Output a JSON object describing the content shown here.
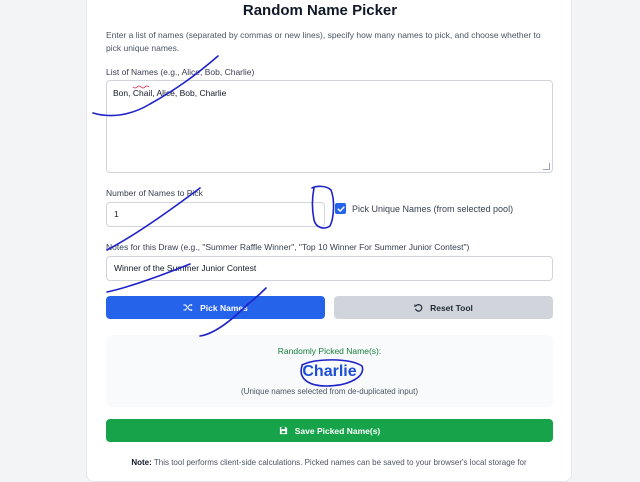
{
  "header": {
    "title": "Random Name Picker",
    "description": "Enter a list of names (separated by commas or new lines), specify how many names to pick, and choose whether to pick unique names."
  },
  "names": {
    "label": "List of Names (e.g., Alice, Bob, Charlie)",
    "value": "Bon, Chail, Alice, Bob, Charlie"
  },
  "count": {
    "label": "Number of Names to Pick",
    "value": "1"
  },
  "unique": {
    "label": "Pick Unique Names (from selected pool)",
    "checked": true
  },
  "notes": {
    "label": "Notes for this Draw (e.g., \"Summer Raffle Winner\", \"Top 10 Winner For Summer Junior Contest\")",
    "value": "Winner of the Summer Junior Contest"
  },
  "actions": {
    "pick_label": "Pick Names",
    "reset_label": "Reset Tool",
    "save_label": "Save Picked Name(s)"
  },
  "result": {
    "label": "Randomly Picked Name(s):",
    "name": "Charlie",
    "note": "(Unique names selected from de-duplicated input)"
  },
  "footer": {
    "note_label": "Note:",
    "text": "This tool performs client-side calculations. Picked names can be saved to your browser's local storage for"
  },
  "icons": {
    "pick": "shuffle-icon",
    "reset": "undo-icon",
    "save": "save-icon",
    "check": "check-icon"
  },
  "colors": {
    "primary": "#2563eb",
    "success": "#16a34a",
    "secondary": "#d1d5db",
    "result_name": "#1d4ed8",
    "result_label": "#15803d",
    "annotation_ink": "#1e22c8"
  }
}
